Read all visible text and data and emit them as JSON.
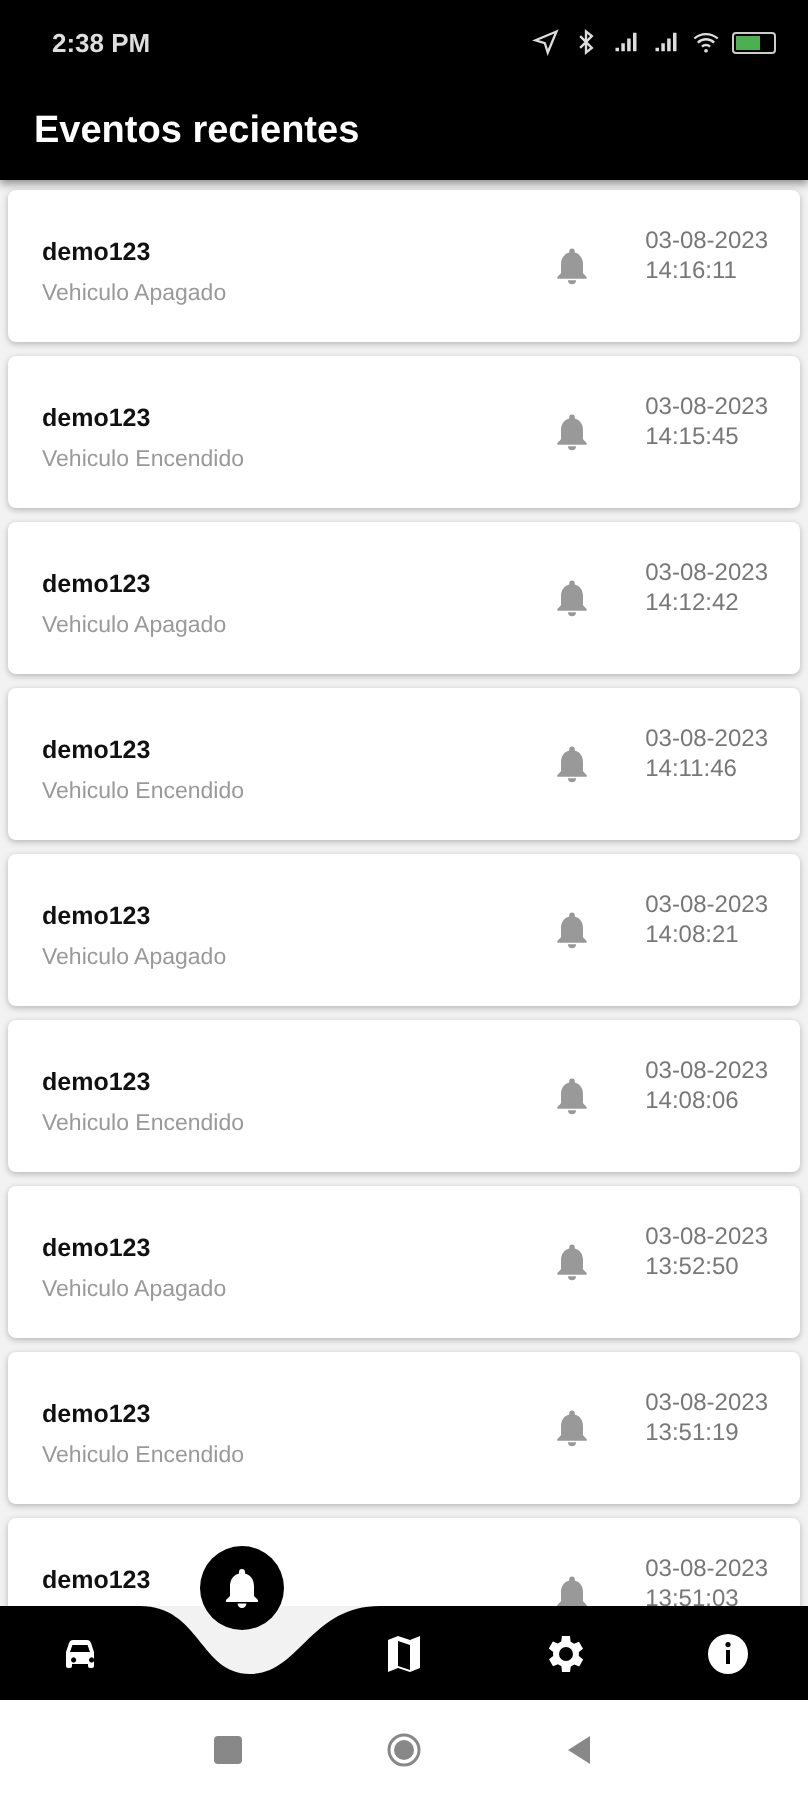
{
  "status_bar": {
    "time": "2:38 PM"
  },
  "app_bar": {
    "title": "Eventos recientes"
  },
  "events": [
    {
      "device": "demo123",
      "event": "Vehiculo Apagado",
      "date": "03-08-2023",
      "time": "14:16:11"
    },
    {
      "device": "demo123",
      "event": "Vehiculo Encendido",
      "date": "03-08-2023",
      "time": "14:15:45"
    },
    {
      "device": "demo123",
      "event": "Vehiculo Apagado",
      "date": "03-08-2023",
      "time": "14:12:42"
    },
    {
      "device": "demo123",
      "event": "Vehiculo Encendido",
      "date": "03-08-2023",
      "time": "14:11:46"
    },
    {
      "device": "demo123",
      "event": "Vehiculo Apagado",
      "date": "03-08-2023",
      "time": "14:08:21"
    },
    {
      "device": "demo123",
      "event": "Vehiculo Encendido",
      "date": "03-08-2023",
      "time": "14:08:06"
    },
    {
      "device": "demo123",
      "event": "Vehiculo Apagado",
      "date": "03-08-2023",
      "time": "13:52:50"
    },
    {
      "device": "demo123",
      "event": "Vehiculo Encendido",
      "date": "03-08-2023",
      "time": "13:51:19"
    },
    {
      "device": "demo123",
      "date": "03-08-2023",
      "time": "13:51:03"
    }
  ],
  "bottom_nav": [
    {
      "kind": "car",
      "selected": false
    },
    {
      "kind": "bell",
      "selected": true
    },
    {
      "kind": "map",
      "selected": false
    },
    {
      "kind": "gear",
      "selected": false
    },
    {
      "kind": "info",
      "selected": false
    }
  ]
}
